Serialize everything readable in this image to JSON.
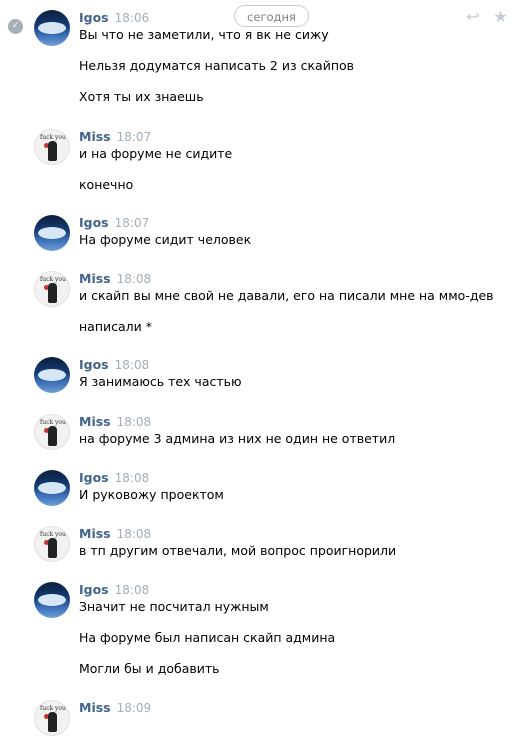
{
  "date_divider": "сегодня",
  "messages": [
    {
      "author": "Igos",
      "time": "18:06",
      "lines": [
        "Вы что не заметили, что я вк не сижу",
        "Нельзя додуматся написать 2 из скайпов",
        "Хотя ты их знаешь"
      ]
    },
    {
      "author": "Miss",
      "time": "18:07",
      "lines": [
        "и на форуме не сидите",
        "конечно"
      ]
    },
    {
      "author": "Igos",
      "time": "18:07",
      "lines": [
        "На форуме сидит человек"
      ]
    },
    {
      "author": "Miss",
      "time": "18:08",
      "lines": [
        "и скайп вы мне свой не давали, его на писали мне на ммо-дев",
        "написали *"
      ]
    },
    {
      "author": "Igos",
      "time": "18:08",
      "lines": [
        "Я занимаюсь тех частью"
      ]
    },
    {
      "author": "Miss",
      "time": "18:08",
      "lines": [
        "на форуме 3 админа из них не один не ответил"
      ]
    },
    {
      "author": "Igos",
      "time": "18:08",
      "lines": [
        "И руковожу проектом"
      ]
    },
    {
      "author": "Miss",
      "time": "18:08",
      "lines": [
        "в тп другим отвечали, мой вопрос проигнорили"
      ]
    },
    {
      "author": "Igos",
      "time": "18:08",
      "lines": [
        "Значит не посчитал нужным",
        "На форуме был написан скайп админа",
        "Могли бы и добавить"
      ]
    },
    {
      "author": "Miss",
      "time": "18:09",
      "lines": []
    }
  ],
  "icons": {
    "reply": "reply-icon",
    "star": "star-icon",
    "check": "check-icon"
  },
  "colors": {
    "author_name": "#42648b",
    "time": "#a3adb8",
    "pill_border": "#c7ccd1"
  }
}
